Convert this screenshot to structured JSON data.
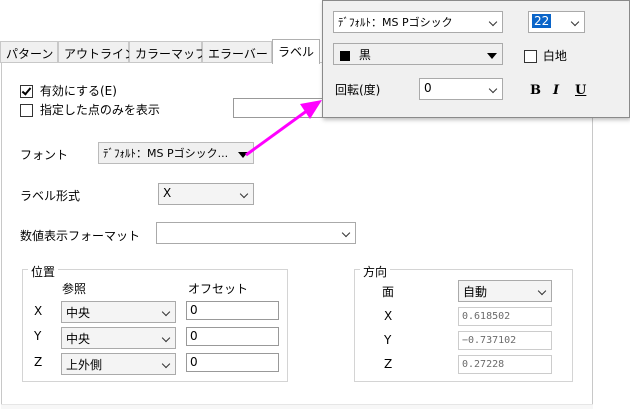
{
  "tabs": [
    {
      "label": "パターン"
    },
    {
      "label": "アウトライン"
    },
    {
      "label": "カラーマップ"
    },
    {
      "label": "エラーバー"
    },
    {
      "label": "ラベル"
    }
  ],
  "enable": {
    "label": "有効にする(E)",
    "checked": true
  },
  "only_points": {
    "label": "指定した点のみを表示",
    "checked": false,
    "value": ""
  },
  "font": {
    "label": "フォント",
    "value": "ﾃﾞﾌｫﾙﾄ：MS Pゴシック..."
  },
  "label_format": {
    "label": "ラベル形式",
    "value": "X"
  },
  "numeric_format": {
    "label": "数値表示フォーマット",
    "value": ""
  },
  "position": {
    "title": "位置",
    "ref_header": "参照",
    "offset_header": "オフセット",
    "rows": [
      {
        "axis": "X",
        "ref": "中央",
        "offset": "0"
      },
      {
        "axis": "Y",
        "ref": "中央",
        "offset": "0"
      },
      {
        "axis": "Z",
        "ref": "上外側",
        "offset": "0"
      }
    ]
  },
  "direction": {
    "title": "方向",
    "plane_label": "面",
    "plane_value": "自動",
    "rows": [
      {
        "axis": "X",
        "value": "0.618502"
      },
      {
        "axis": "Y",
        "value": "−0.737102"
      },
      {
        "axis": "Z",
        "value": "0.27228"
      }
    ]
  },
  "popup": {
    "font_value": "ﾃﾞﾌｫﾙﾄ：MS Pゴシック",
    "size_value": "22",
    "color_value": "黒",
    "white_bg_label": "白地",
    "white_bg_checked": false,
    "rotation_label": "回転(度)",
    "rotation_value": "0",
    "bold": "B",
    "italic": "I",
    "underline": "U"
  },
  "colors": {
    "arrow": "#ff00ff",
    "highlight": "#0a64c8"
  }
}
